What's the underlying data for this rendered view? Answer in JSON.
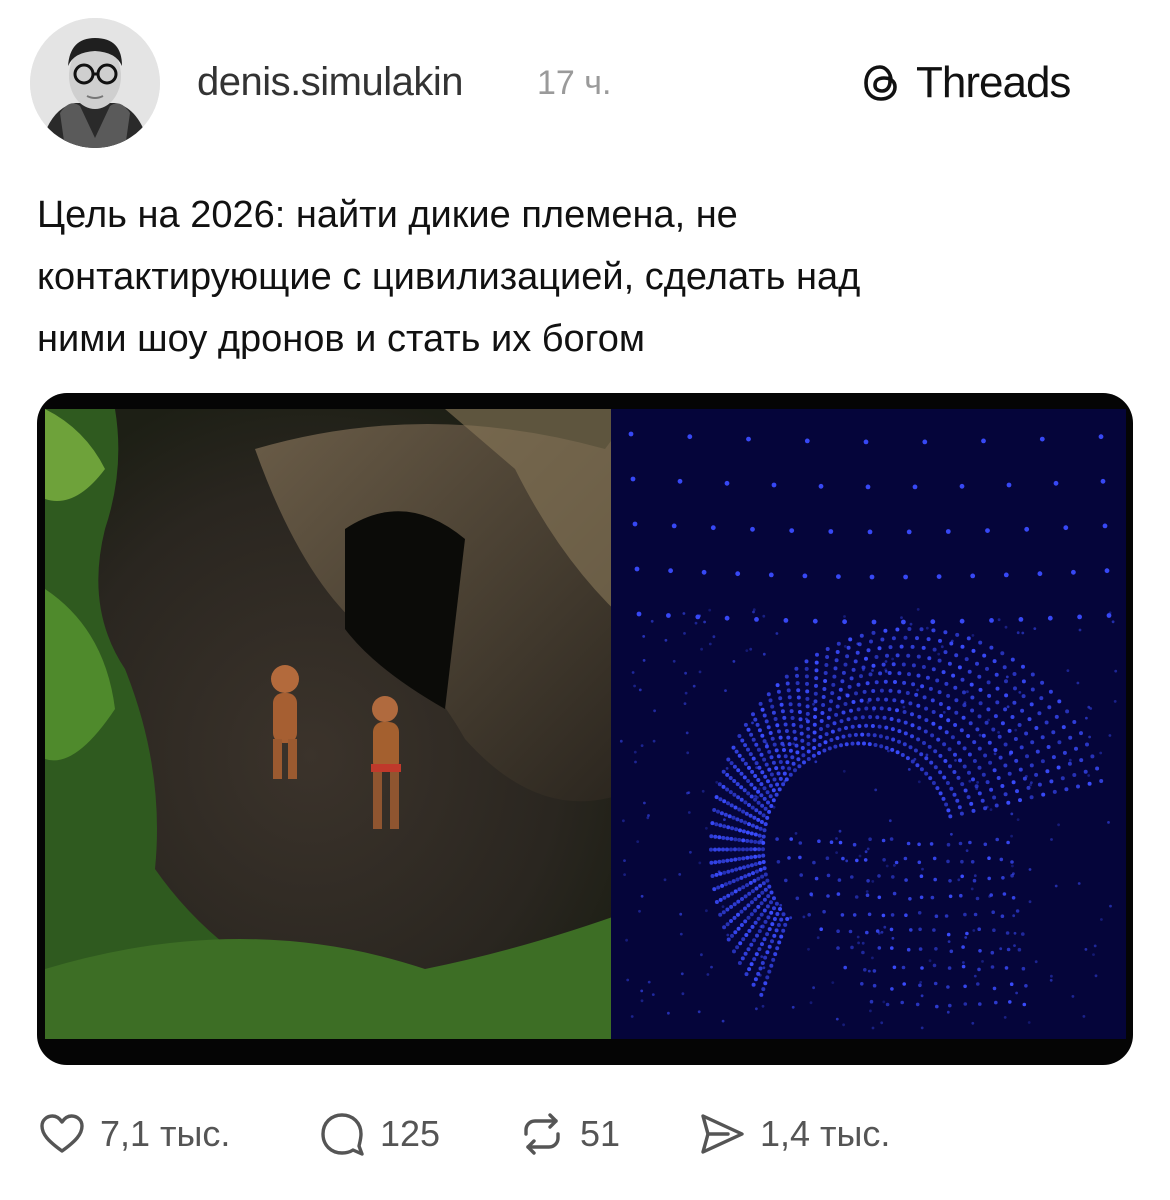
{
  "post": {
    "username": "denis.simulakin",
    "time": "17 ч.",
    "brand": "Threads",
    "caption_lines": [
      "Цель на 2026: найти дикие племена, не",
      "контактирующие с цивилизацией, сделать над",
      "ними шоу дронов и стать их богом"
    ]
  },
  "actions": {
    "likes": "7,1 тыс.",
    "comments": "125",
    "reposts": "51",
    "shares": "1,4 тыс."
  },
  "icons": {
    "like": "heart-icon",
    "comment": "comment-bubble-icon",
    "repost": "repost-icon",
    "share": "send-icon",
    "brand": "threads-logo-icon"
  },
  "colors": {
    "drone_blue": "#3a4cff",
    "night_sky": "#05053a"
  }
}
